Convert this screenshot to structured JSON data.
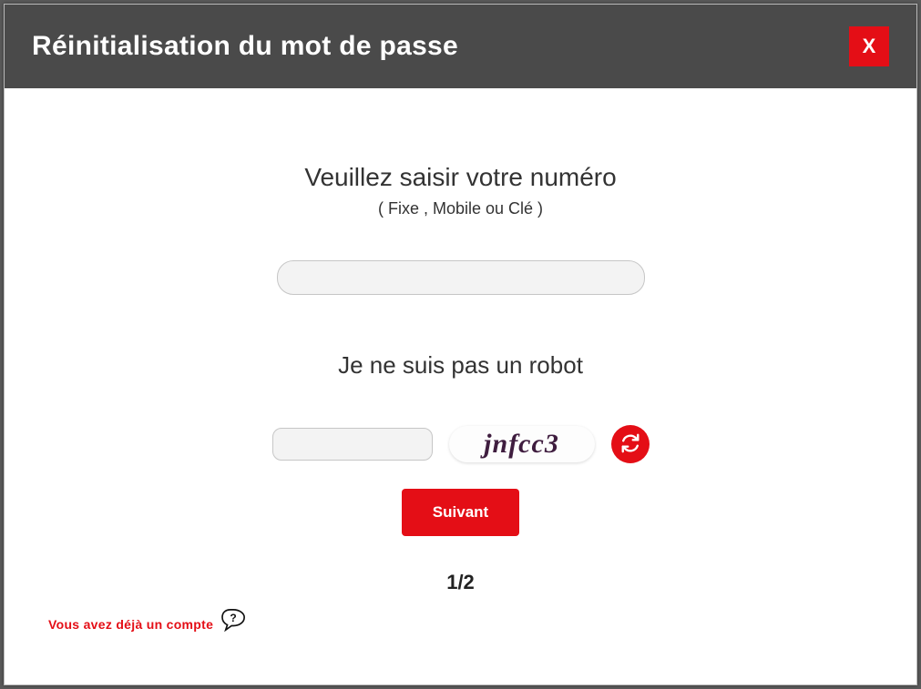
{
  "modal": {
    "title": "Réinitialisation du mot de passe",
    "close_label": "X"
  },
  "form": {
    "prompt_title": "Veuillez saisir votre numéro",
    "prompt_sub": "( Fixe , Mobile ou Clé )",
    "number_value": "",
    "captcha_title": "Je ne suis pas un robot",
    "captcha_input_value": "",
    "captcha_text": "jnfcc3",
    "next_label": "Suivant",
    "step_indicator": "1/2"
  },
  "footer": {
    "existing_account": "Vous avez déjà un compte"
  }
}
